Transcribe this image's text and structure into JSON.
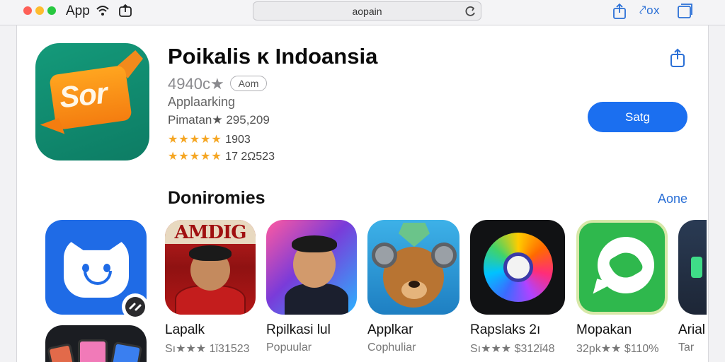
{
  "toolbar": {
    "app_menu": "App",
    "address": "aopain",
    "right_label": "ox"
  },
  "hero": {
    "title": "Poikalis ĸ Indoansia",
    "rating": "4940c★",
    "age_badge": "Aom",
    "category": "Applaarking",
    "pirated": "Pimatan★ 295,209",
    "stars_rows": [
      {
        "stars": "★★★★★",
        "text": " 1903"
      },
      {
        "stars": "★★★★★",
        "text": " 17 2Ω523"
      }
    ],
    "get_button": "Satg"
  },
  "section": {
    "title": "Doniromies",
    "see_all": "Aone"
  },
  "apps": [
    {
      "name": "Lapalk",
      "sub": "Sı★★★ 1ǐ31523"
    },
    {
      "name": "Rpilkasi lul",
      "sub": "Popuular",
      "banner": "AMDIG"
    },
    {
      "name": "Applkar",
      "sub": "Cophuliar"
    },
    {
      "name": "Rapslaks 2ı",
      "sub": "Sı★★★ $312ǐ48"
    },
    {
      "name": "Mopakan",
      "sub": "32pk★★ $110%"
    },
    {
      "name": "Arial",
      "sub": "Tar"
    }
  ],
  "colors": {
    "accent": "#1b6ff0",
    "star": "#f5a623",
    "link": "#2a6fd6"
  }
}
